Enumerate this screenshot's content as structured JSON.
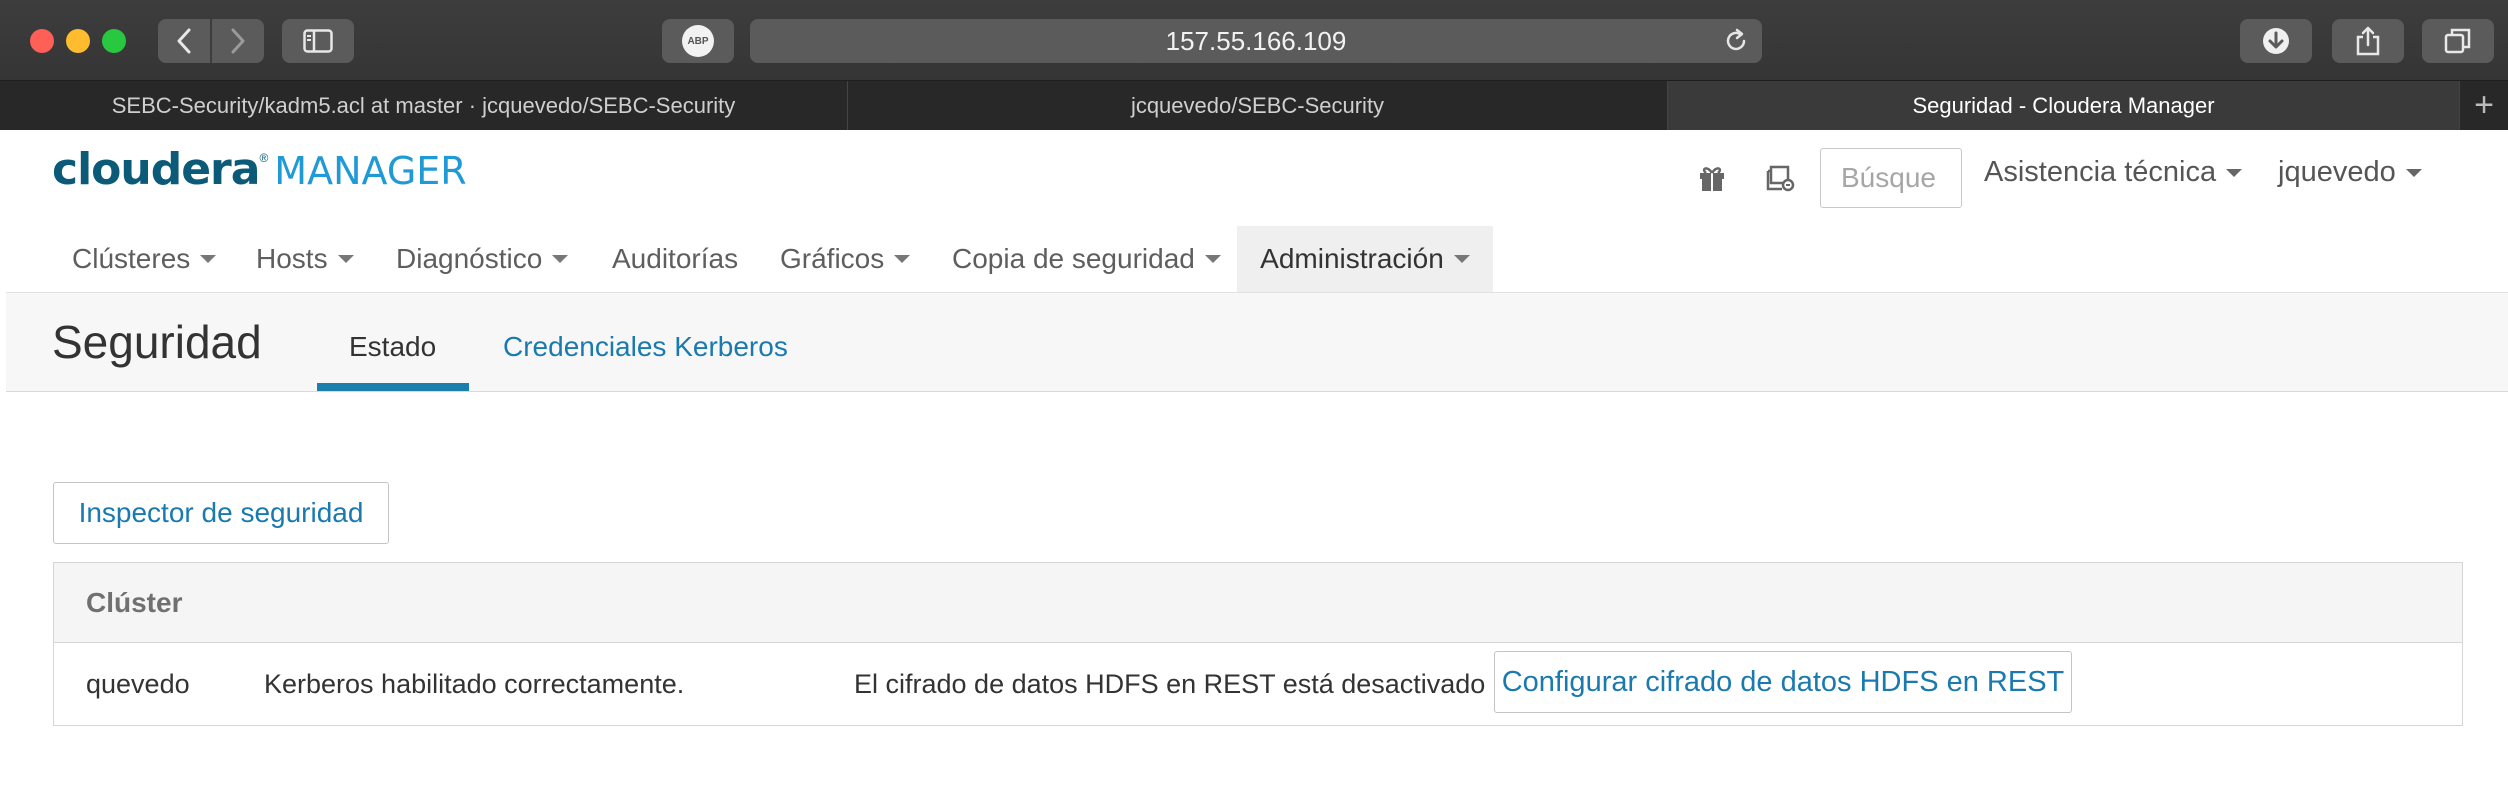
{
  "browser": {
    "url": "157.55.166.109",
    "adblock_label": "ABP",
    "tabs": [
      {
        "label": "SEBC-Security/kadm5.acl at master · jcquevedo/SEBC-Security",
        "active": false
      },
      {
        "label": "jcquevedo/SEBC-Security",
        "active": false
      },
      {
        "label": "Seguridad - Cloudera Manager",
        "active": true
      }
    ],
    "new_tab_symbol": "+"
  },
  "header": {
    "logo_brand": "cloudera",
    "logo_reg": "®",
    "logo_product": "MANAGER",
    "search_placeholder": "Búsque",
    "support_label": "Asistencia técnica",
    "user_label": "jquevedo",
    "icons": [
      "gift-icon",
      "parcels-icon"
    ]
  },
  "mainnav": {
    "items": [
      {
        "label": "Clústeres",
        "dropdown": true
      },
      {
        "label": "Hosts",
        "dropdown": true
      },
      {
        "label": "Diagnóstico",
        "dropdown": true
      },
      {
        "label": "Auditorías",
        "dropdown": false
      },
      {
        "label": "Gráficos",
        "dropdown": true
      },
      {
        "label": "Copia de seguridad",
        "dropdown": true
      },
      {
        "label": "Administración",
        "dropdown": true,
        "active": true
      }
    ]
  },
  "page": {
    "title": "Seguridad",
    "tabs": [
      {
        "label": "Estado",
        "active": true
      },
      {
        "label": "Credenciales Kerberos",
        "active": false
      }
    ],
    "inspector_button": "Inspector de seguridad",
    "table": {
      "header": "Clúster",
      "row": {
        "cluster": "quevedo",
        "kerberos_status": "Kerberos habilitado correctamente.",
        "hdfs_status": "El cifrado de datos HDFS en REST está desactivado",
        "configure_button": "Configurar cifrado de datos HDFS en REST"
      }
    }
  },
  "colors": {
    "brand_dark": "#0b5a78",
    "brand_light": "#1f9ad6",
    "link": "#1a7ab0",
    "active_tab_underline": "#1d7fae"
  }
}
